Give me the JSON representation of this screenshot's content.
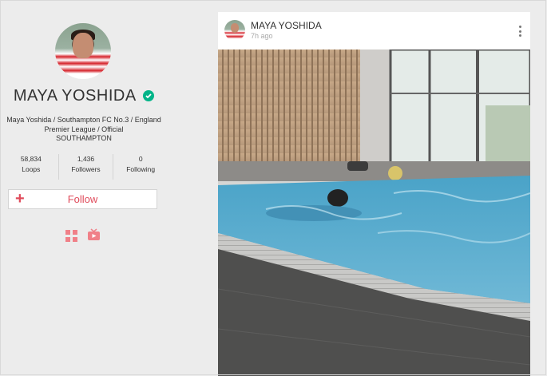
{
  "profile": {
    "name": "MAYA YOSHIDA",
    "verified": true,
    "bio_lines": [
      "Maya Yoshida / Southampton FC No.3 / England",
      "Premier League / Official",
      "SOUTHAMPTON"
    ],
    "stats": [
      {
        "value": "58,834",
        "label": "Loops"
      },
      {
        "value": "1,436",
        "label": "Followers"
      },
      {
        "value": "0",
        "label": "Following"
      }
    ],
    "follow_label": "Follow",
    "accent_color": "#e04c5c"
  },
  "post": {
    "author": "MAYA YOSHIDA",
    "time": "7h ago"
  },
  "icons": [
    "verified-icon",
    "plus-icon",
    "grid-view-icon",
    "tv-view-icon",
    "more-options-icon"
  ]
}
